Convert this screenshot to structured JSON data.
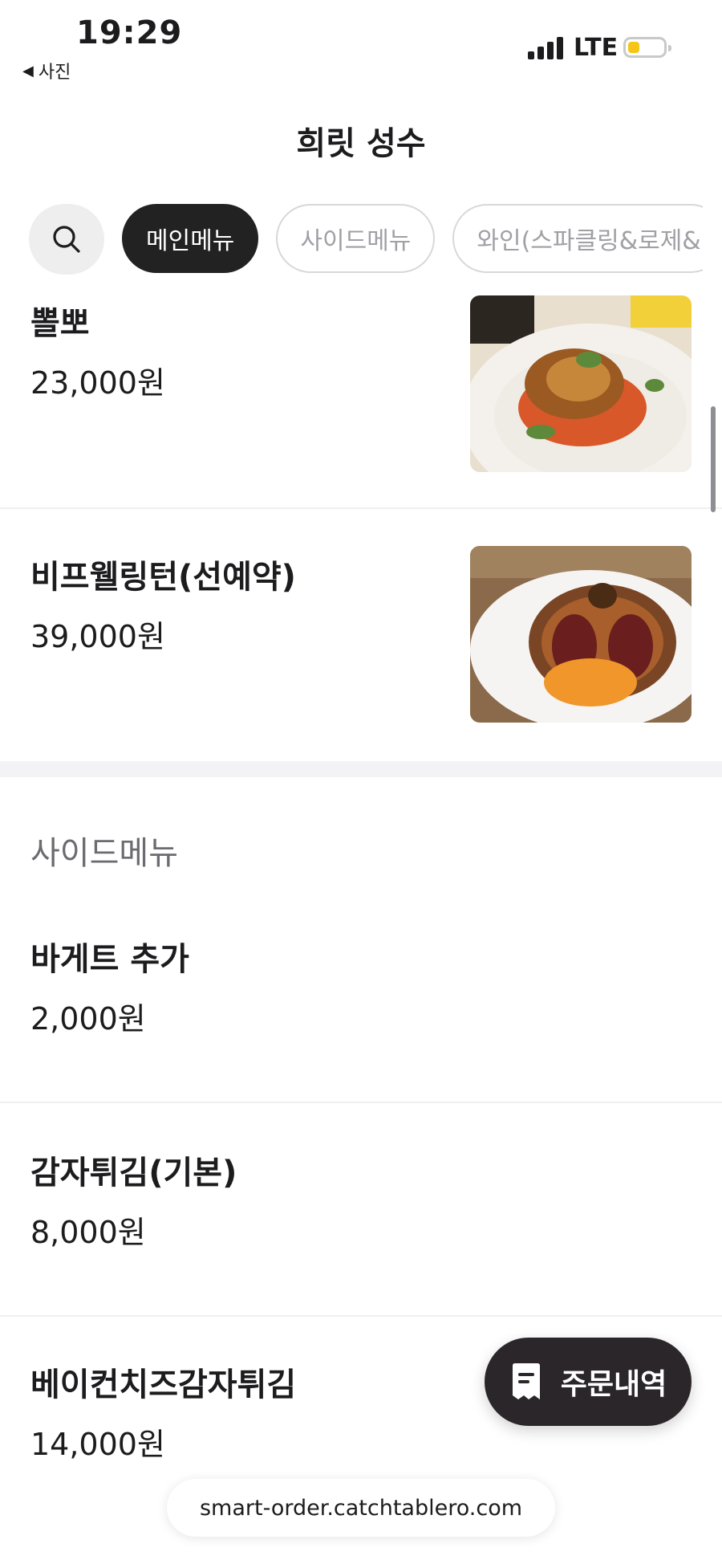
{
  "status_bar": {
    "time": "19:29",
    "back_label": "사진",
    "carrier": "LTE",
    "battery_level": 0.25,
    "battery_color": "#f5c518"
  },
  "header": {
    "title": "희릿 성수"
  },
  "categories": {
    "search_icon": "search-icon",
    "chips": [
      {
        "label": "메인메뉴",
        "active": true
      },
      {
        "label": "사이드메뉴",
        "active": false
      },
      {
        "label": "와인(스파클링&로제&",
        "active": false
      }
    ]
  },
  "main_menu": {
    "items": [
      {
        "name": "뽈뽀",
        "price": "23,000원"
      },
      {
        "name": "비프웰링턴(선예약)",
        "price": "39,000원"
      }
    ]
  },
  "side_menu": {
    "title": "사이드메뉴",
    "items": [
      {
        "name": "바게트 추가",
        "price": "2,000원"
      },
      {
        "name": "감자튀김(기본)",
        "price": "8,000원"
      },
      {
        "name": "베이컨치즈감자튀김",
        "price": "14,000원"
      }
    ]
  },
  "order_button": {
    "label": "주문내역",
    "icon": "receipt-icon"
  },
  "url_bar": {
    "url": "smart-order.catchtablero.com"
  },
  "colors": {
    "active_chip": "#222222",
    "order_button": "#2a2629"
  }
}
